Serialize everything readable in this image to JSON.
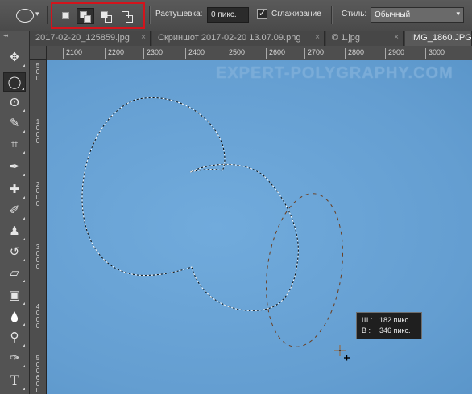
{
  "options_bar": {
    "tool_preset_icon": "elliptical-marquee-icon",
    "tool_preset_arrow": "▾",
    "selection_modes": [
      {
        "name": "new-selection",
        "active": false
      },
      {
        "name": "add-to-selection",
        "active": true
      },
      {
        "name": "subtract-from-selection",
        "active": false
      },
      {
        "name": "intersect-with-selection",
        "active": false
      }
    ],
    "highlight_color": "#d3141c",
    "feather_label": "Растушевка:",
    "feather_value": "0 пикс.",
    "antialias_checked": "✓",
    "antialias_label": "Сглаживание",
    "style_label": "Стиль:",
    "style_value": "Обычный",
    "style_caret": "▾"
  },
  "toolbar": {
    "grip": "◂◂",
    "tools": [
      {
        "icon": "move-icon",
        "glyph": "✥",
        "active": false
      },
      {
        "icon": "elliptical-marquee-icon",
        "glyph": "◯",
        "active": true
      },
      {
        "icon": "lasso-icon",
        "glyph": "ʘ",
        "active": false
      },
      {
        "icon": "quick-selection-icon",
        "glyph": "✎",
        "active": false
      },
      {
        "icon": "crop-icon",
        "glyph": "⌗",
        "active": false
      },
      {
        "icon": "eyedropper-icon",
        "glyph": "✒",
        "active": false
      },
      {
        "icon": "healing-brush-icon",
        "glyph": "✚",
        "active": false
      },
      {
        "icon": "brush-icon",
        "glyph": "✐",
        "active": false
      },
      {
        "icon": "clone-stamp-icon",
        "glyph": "♟",
        "active": false
      },
      {
        "icon": "history-brush-icon",
        "glyph": "↺",
        "active": false
      },
      {
        "icon": "eraser-icon",
        "glyph": "▱",
        "active": false
      },
      {
        "icon": "gradient-icon",
        "glyph": "▣",
        "active": false
      },
      {
        "icon": "blur-icon",
        "glyph": "💧",
        "active": false
      },
      {
        "icon": "dodge-icon",
        "glyph": "⚲",
        "active": false
      },
      {
        "icon": "pen-icon",
        "glyph": "✑",
        "active": false
      },
      {
        "icon": "type-icon",
        "glyph": "T",
        "active": false
      }
    ]
  },
  "tabs": [
    {
      "label": "2017-02-20_125859.jpg",
      "close": "×",
      "active": false
    },
    {
      "label": "Скриншот 2017-02-20 13.07.09.png",
      "close": "×",
      "active": false
    },
    {
      "label": "© 1.jpg",
      "close": "×",
      "active": false
    },
    {
      "label": "IMG_1860.JPG",
      "close": "×",
      "active": true
    }
  ],
  "ruler": {
    "h_ticks": [
      "2100",
      "2200",
      "2300",
      "2400",
      "2500",
      "2600",
      "2700",
      "2800",
      "2900",
      "3000"
    ],
    "v_ticks": [
      "5",
      "0",
      "0",
      "1",
      "0",
      "0",
      "0",
      "2",
      "0",
      "0",
      "0",
      "3",
      "0",
      "0",
      "0",
      "4",
      "0",
      "0",
      "0",
      "5",
      "0",
      "0",
      "6",
      "0",
      "0"
    ]
  },
  "canvas": {
    "color": "#6aa4d6",
    "watermark": "EXPERT-POLYGRAPHY.COM"
  },
  "tooltip": {
    "w_key": "Ш :",
    "w_value": "182 пикс.",
    "h_key": "В :",
    "h_value": "346 пикс."
  },
  "cursor_icon": "crosshair-plus-icon"
}
